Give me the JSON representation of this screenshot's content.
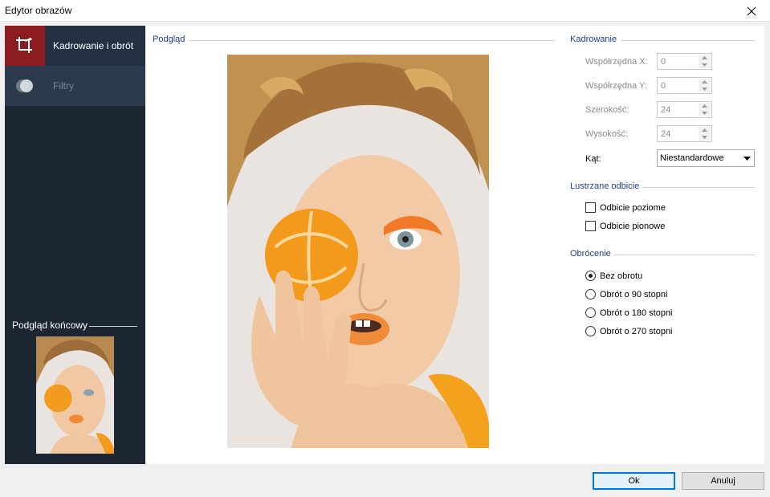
{
  "window": {
    "title": "Edytor obrazów",
    "close_icon": "close-icon"
  },
  "sidebar": {
    "items": [
      {
        "label": "Kadrowanie i obrót",
        "icon": "crop-rotate-icon",
        "active": true
      },
      {
        "label": "Filtry",
        "icon": "filters-icon",
        "active": false
      }
    ],
    "final_preview_label": "Podgląd końcowy"
  },
  "preview": {
    "label": "Podgląd"
  },
  "crop": {
    "label": "Kadrowanie",
    "fields": [
      {
        "label": "Współrzędna X:",
        "value": "0"
      },
      {
        "label": "Współrzędna Y:",
        "value": "0"
      },
      {
        "label": "Szerokość:",
        "value": "24"
      },
      {
        "label": "Wysokość:",
        "value": "24"
      }
    ],
    "angle_label": "Kąt:",
    "angle_value": "Niestandardowe"
  },
  "mirror": {
    "label": "Lustrzane odbicie",
    "options": [
      {
        "label": "Odbicie poziome",
        "checked": false
      },
      {
        "label": "Odbicie pionowe",
        "checked": false
      }
    ]
  },
  "rotation": {
    "label": "Obrócenie",
    "options": [
      {
        "label": "Bez obrotu",
        "selected": true
      },
      {
        "label": "Obrót o 90 stopni",
        "selected": false
      },
      {
        "label": "Obrót o 180 stopni",
        "selected": false
      },
      {
        "label": "Obrót o 270 stopni",
        "selected": false
      }
    ]
  },
  "buttons": {
    "ok": "Ok",
    "cancel": "Anuluj"
  },
  "colors": {
    "sidebar_bg": "#1d2733",
    "active_icon_bg": "#8b1d22",
    "section_label": "#1f3d8f",
    "default_button_border": "#0078d7"
  }
}
